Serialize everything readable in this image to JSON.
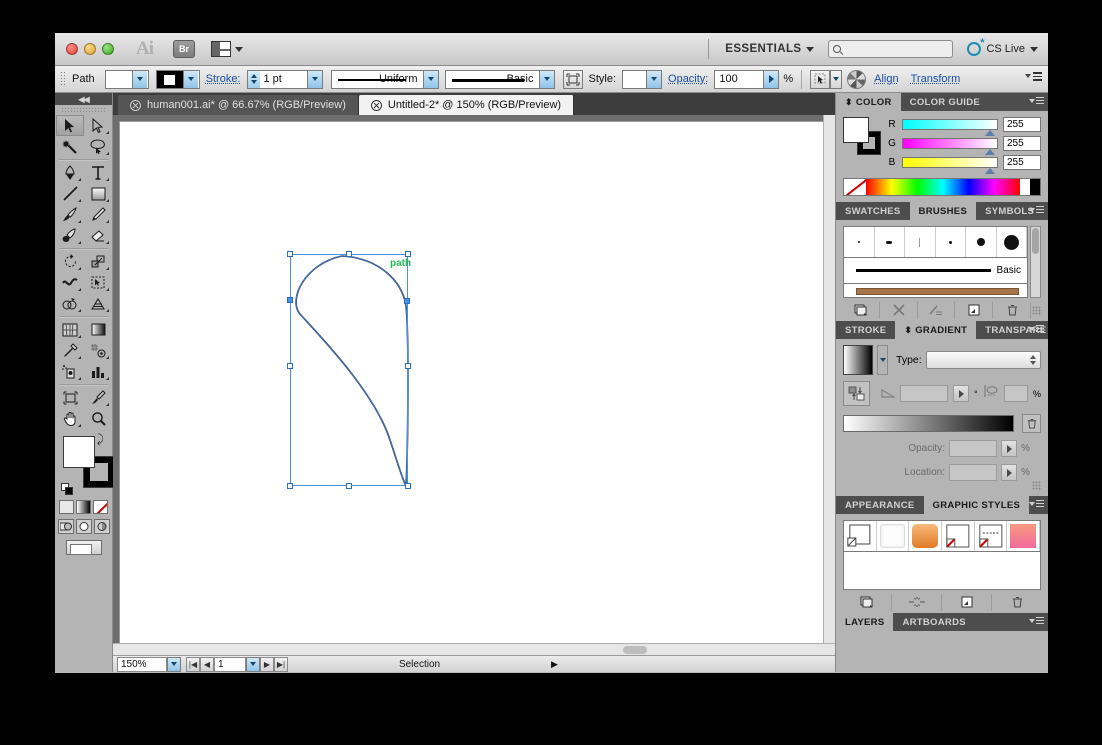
{
  "window": {
    "app_icon": "Ai",
    "bridge_button": "Br",
    "workspace": "ESSENTIALS",
    "search_placeholder": "",
    "cs_live": "CS Live",
    "traffic_lights": [
      "close",
      "minimize",
      "zoom"
    ]
  },
  "control_bar": {
    "object_label": "Path",
    "fill_swatch_color": "#ffffff",
    "stroke_swatch_color": "#000000",
    "stroke_label": "Stroke:",
    "stroke_weight": "1 pt",
    "profile_label": "Uniform",
    "brush_label": "Basic",
    "style_label": "Style:",
    "opacity_label": "Opacity:",
    "opacity_value": "100",
    "percent": "%",
    "align_link": "Align",
    "transform_link": "Transform"
  },
  "tabs": [
    {
      "label": "human001.ai* @ 66.67% (RGB/Preview)",
      "active": false
    },
    {
      "label": "Untitled-2* @ 150% (RGB/Preview)",
      "active": true
    }
  ],
  "tools": [
    {
      "name": "selection-tool",
      "active": true
    },
    {
      "name": "direct-selection-tool",
      "active": false
    },
    {
      "name": "magic-wand-tool",
      "active": false
    },
    {
      "name": "lasso-tool",
      "active": false
    },
    {
      "name": "pen-tool",
      "active": false
    },
    {
      "name": "type-tool",
      "active": false
    },
    {
      "name": "line-segment-tool",
      "active": false
    },
    {
      "name": "rectangle-tool",
      "active": false
    },
    {
      "name": "paintbrush-tool",
      "active": false
    },
    {
      "name": "pencil-tool",
      "active": false
    },
    {
      "name": "blob-brush-tool",
      "active": false
    },
    {
      "name": "eraser-tool",
      "active": false
    },
    {
      "name": "rotate-tool",
      "active": false
    },
    {
      "name": "scale-tool",
      "active": false
    },
    {
      "name": "width-tool",
      "active": false
    },
    {
      "name": "free-transform-tool",
      "active": false
    },
    {
      "name": "shape-builder-tool",
      "active": false
    },
    {
      "name": "perspective-grid-tool",
      "active": false
    },
    {
      "name": "mesh-tool",
      "active": false
    },
    {
      "name": "gradient-tool",
      "active": false
    },
    {
      "name": "eyedropper-tool",
      "active": false
    },
    {
      "name": "blend-tool",
      "active": false
    },
    {
      "name": "symbol-sprayer-tool",
      "active": false
    },
    {
      "name": "column-graph-tool",
      "active": false
    },
    {
      "name": "artboard-tool",
      "active": false
    },
    {
      "name": "slice-tool",
      "active": false
    },
    {
      "name": "hand-tool",
      "active": false
    },
    {
      "name": "zoom-tool",
      "active": false
    }
  ],
  "canvas": {
    "object_label": "path",
    "selection_color": "#4a90e2",
    "smart_guide_color": "#23c14e",
    "artwork_stroke_color": "#1b1b2e"
  },
  "status_bar": {
    "zoom_level": "150%",
    "page_number": "1",
    "status_text": "Selection"
  },
  "panels": {
    "color": {
      "tabs": [
        {
          "label": "COLOR",
          "active": true
        },
        {
          "label": "COLOR GUIDE",
          "active": false
        }
      ],
      "channels": [
        {
          "label": "R",
          "value": "255"
        },
        {
          "label": "G",
          "value": "255"
        },
        {
          "label": "B",
          "value": "255"
        }
      ]
    },
    "brushes": {
      "tabs": [
        {
          "label": "SWATCHES",
          "active": false
        },
        {
          "label": "BRUSHES",
          "active": true
        },
        {
          "label": "SYMBOLS",
          "active": false
        }
      ],
      "presets": [
        2,
        4,
        3,
        4,
        8,
        15
      ],
      "stroke_name": "Basic"
    },
    "gradient": {
      "tabs": [
        {
          "label": "STROKE",
          "active": false
        },
        {
          "label": "GRADIENT",
          "active": true
        },
        {
          "label": "TRANSPARE",
          "active": false
        }
      ],
      "type_label": "Type:",
      "type_value": "",
      "angle_value": "",
      "angle_unit": "°",
      "aspect_value": "",
      "aspect_unit": "%",
      "opacity_label": "Opacity:",
      "opacity_value": "",
      "location_label": "Location:",
      "location_value": "",
      "percent": "%"
    },
    "graphic_styles": {
      "tabs": [
        {
          "label": "APPEARANCE",
          "active": false
        },
        {
          "label": "GRAPHIC STYLES",
          "active": true
        }
      ]
    },
    "layers": {
      "tabs": [
        {
          "label": "LAYERS",
          "active": true
        },
        {
          "label": "ARTBOARDS",
          "active": false
        }
      ]
    }
  }
}
